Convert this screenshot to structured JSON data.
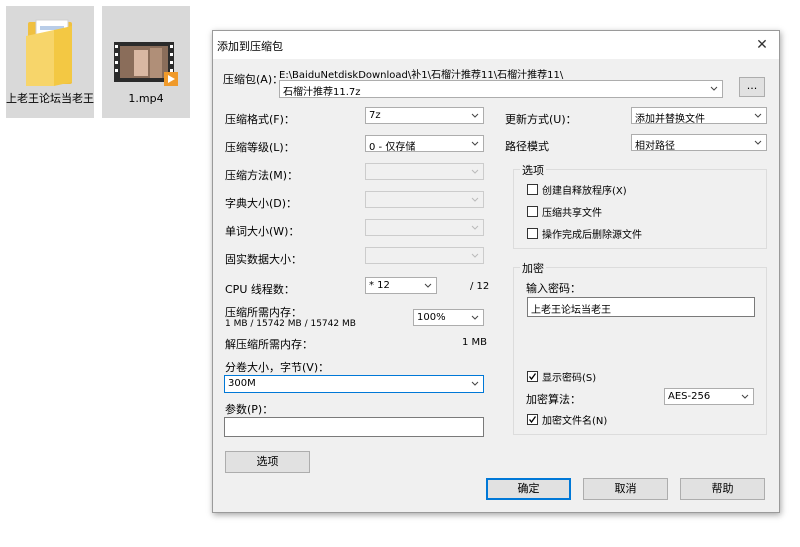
{
  "desktop": {
    "folder_label": "上老王论坛当老王",
    "video_label": "1.mp4"
  },
  "dialog": {
    "title": "添加到压缩包",
    "close_glyph": "✕",
    "archive": {
      "label": "压缩包(A)：",
      "path_text": "E:\\BaiduNetdiskDownload\\补1\\石榴汁推荐11\\石榴汁推荐11\\",
      "name_value": "石榴汁推荐11.7z",
      "browse_label": "..."
    },
    "left": {
      "format_label": "压缩格式(F)：",
      "format_value": "7z",
      "level_label": "压缩等级(L)：",
      "level_value": "0 - 仅存储",
      "method_label": "压缩方法(M)：",
      "dict_label": "字典大小(D)：",
      "word_label": "单词大小(W)：",
      "solid_label": "固实数据大小：",
      "cpu_label": "CPU 线程数：",
      "cpu_value": "* 12",
      "cpu_total": "/ 12",
      "mem_label": "压缩所需内存：",
      "mem_detail": "1 MB / 15742 MB / 15742 MB",
      "mem_value": "100%",
      "decomp_label": "解压缩所需内存：",
      "decomp_value": "1 MB",
      "volume_label": "分卷大小，字节(V)：",
      "volume_value": "300M",
      "params_label": "参数(P)：",
      "params_value": "",
      "options_button": "选项"
    },
    "right": {
      "update_label": "更新方式(U)：",
      "update_value": "添加并替换文件",
      "path_label": "路径模式",
      "path_value": "相对路径",
      "options_group": "选项",
      "opt_sfx": "创建自释放程序(X)",
      "opt_shared": "压缩共享文件",
      "opt_delete": "操作完成后删除源文件",
      "encrypt_group": "加密",
      "password_label": "输入密码：",
      "password_value": "上老王论坛当老王",
      "show_password": "显示密码(S)",
      "enc_method_label": "加密算法：",
      "enc_method_value": "AES-256",
      "encrypt_names": "加密文件名(N)"
    },
    "buttons": {
      "ok": "确定",
      "cancel": "取消",
      "help": "帮助"
    }
  }
}
